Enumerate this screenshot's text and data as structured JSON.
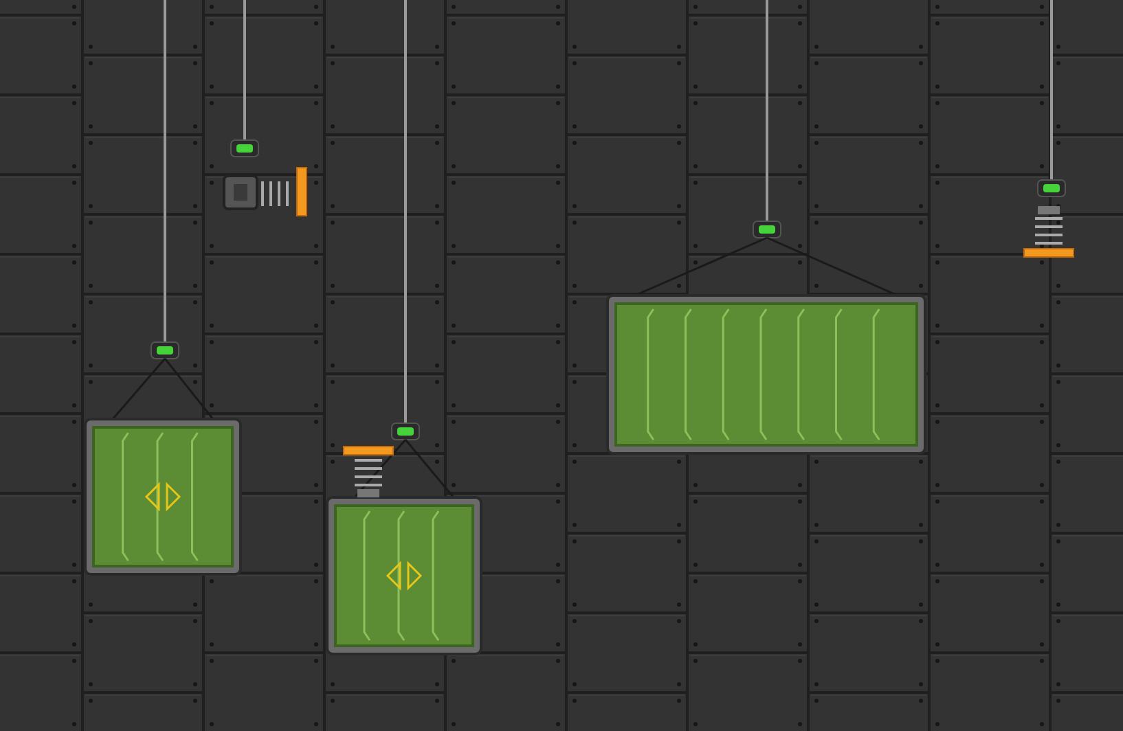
{
  "scene": {
    "objects": [
      {
        "kind": "door-crate"
      },
      {
        "kind": "side-spring"
      },
      {
        "kind": "door-crate-spring"
      },
      {
        "kind": "wide-crate"
      },
      {
        "kind": "up-spring"
      }
    ]
  }
}
